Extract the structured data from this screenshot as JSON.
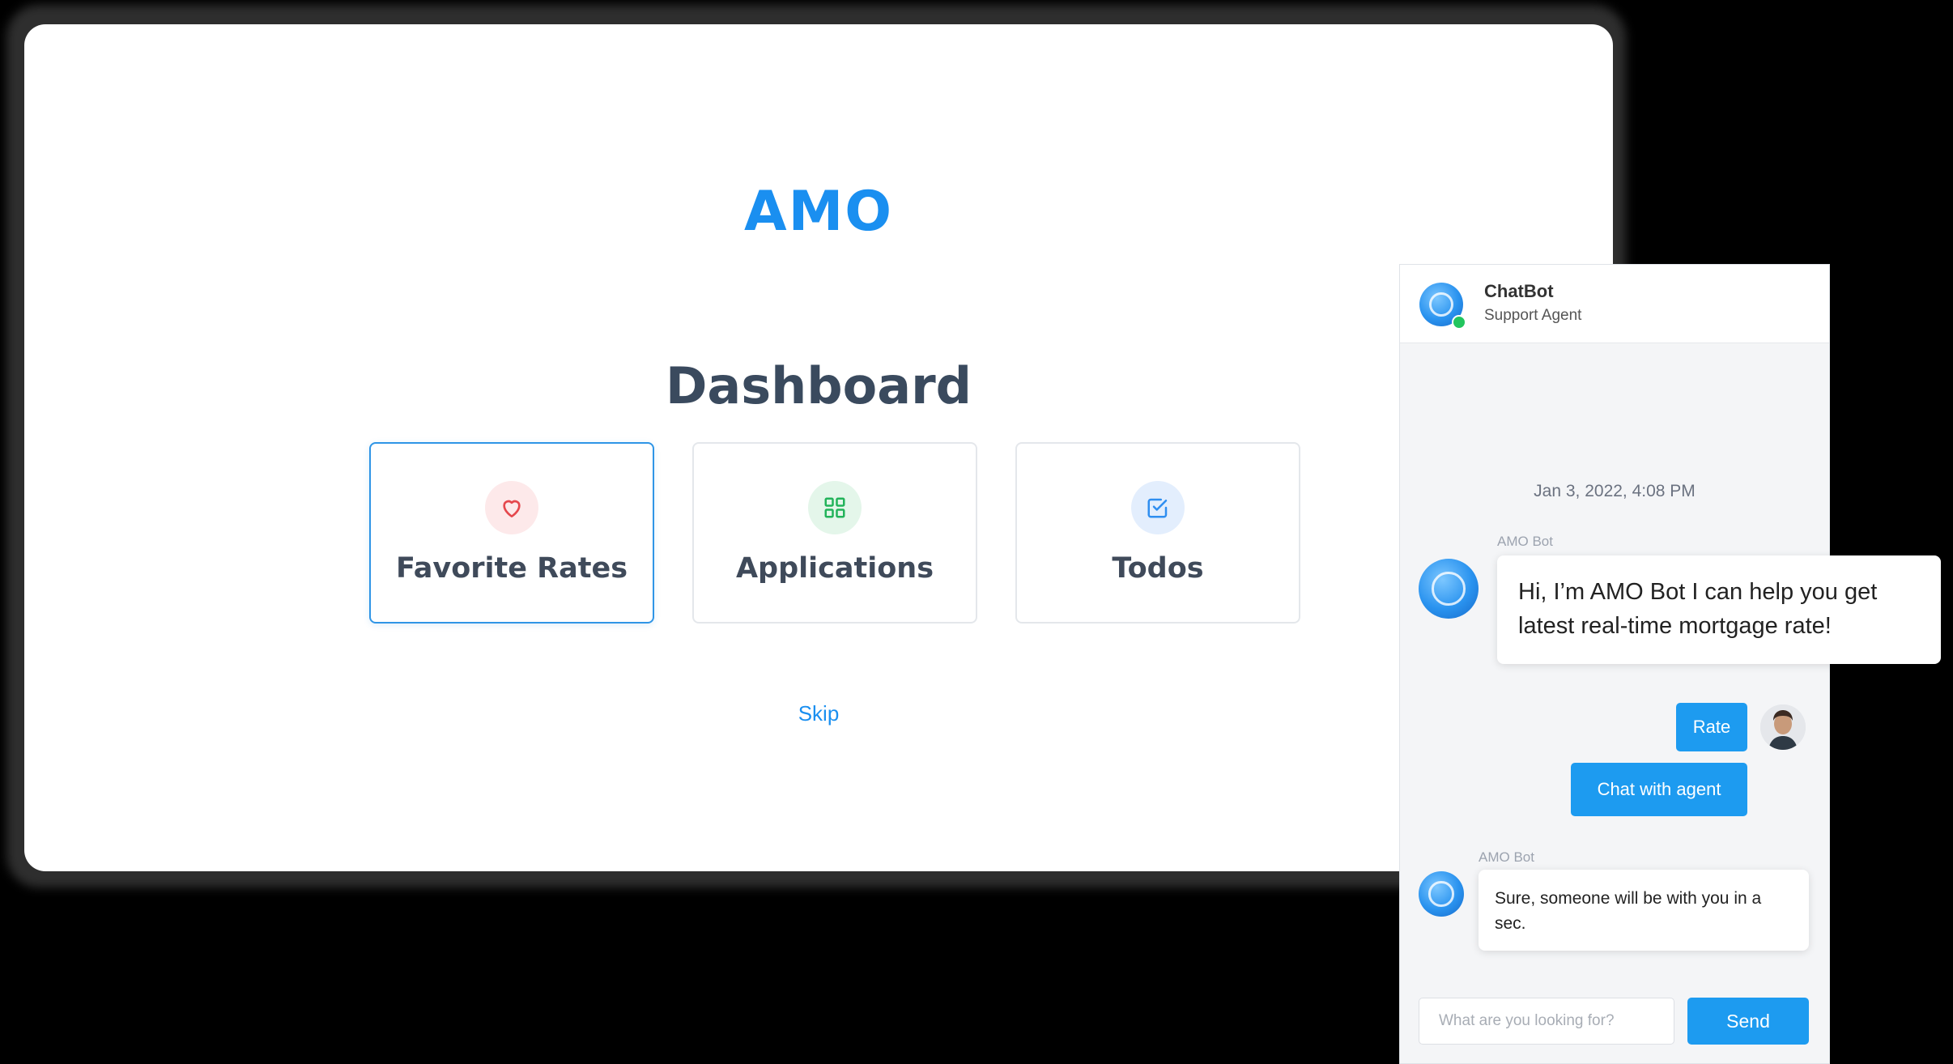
{
  "app": {
    "logo_text": "AMO"
  },
  "dashboard": {
    "title": "Dashboard",
    "tiles": [
      {
        "label": "Favorite Rates",
        "icon": "heart-icon",
        "color": "#e5484d",
        "selected": true
      },
      {
        "label": "Applications",
        "icon": "grid-icon",
        "color": "#22b35a",
        "selected": false
      },
      {
        "label": "Todos",
        "icon": "checkbox-icon",
        "color": "#2f8ef0",
        "selected": false
      }
    ],
    "skip_label": "Skip"
  },
  "chat": {
    "title": "ChatBot",
    "subtitle": "Support Agent",
    "timestamp": "Jan 3, 2022, 4:08 PM",
    "messages": [
      {
        "sender": "AMO Bot",
        "text": "Hi, I’m AMO Bot I can help you get latest real-time mortgage rate!"
      },
      {
        "sender": "AMO Bot",
        "text": "Sure, someone will be with you in a sec."
      }
    ],
    "quick_replies": [
      "Rate",
      "Chat with agent"
    ],
    "input_placeholder": "What are you looking for?",
    "send_label": "Send"
  },
  "colors": {
    "accent": "#1d9bf0",
    "title_text": "#3a4a5e",
    "online": "#22c55e"
  }
}
